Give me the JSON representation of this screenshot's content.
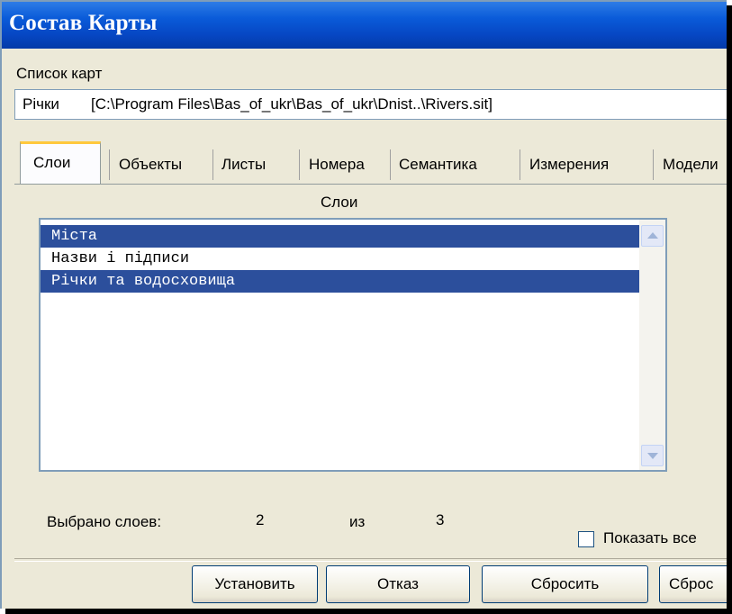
{
  "window": {
    "title": "Состав Карты"
  },
  "maps": {
    "label": "Список  карт",
    "selected_name": "Річки",
    "selected_path": "[C:\\Program Files\\Bas_of_ukr\\Bas_of_ukr\\Dnist..\\Rivers.sit]"
  },
  "tabs": [
    {
      "label": "Слои",
      "active": true
    },
    {
      "label": "Объекты",
      "active": false
    },
    {
      "label": "Листы",
      "active": false
    },
    {
      "label": "Номера",
      "active": false
    },
    {
      "label": "Семантика",
      "active": false
    },
    {
      "label": "Измерения",
      "active": false
    },
    {
      "label": "Модели",
      "active": false
    }
  ],
  "layers": {
    "heading": "Слои",
    "items": [
      {
        "label": "Міста",
        "selected": true
      },
      {
        "label": "Назви і підписи",
        "selected": false
      },
      {
        "label": "Річки та водосховища",
        "selected": true
      }
    ]
  },
  "status": {
    "selected_label": "Выбрано слоев:",
    "selected_count": "2",
    "of_label": "из",
    "total_count": "3"
  },
  "show_all": {
    "label": "Показать все",
    "checked": false
  },
  "buttons": {
    "set": "Установить",
    "cancel": "Отказ",
    "reset": "Сбросить",
    "reset_more": "Сброс"
  },
  "colors": {
    "title_bar": "#0a5bd9",
    "selection": "#2c4f9c",
    "dialog_bg": "#ece9d8"
  }
}
